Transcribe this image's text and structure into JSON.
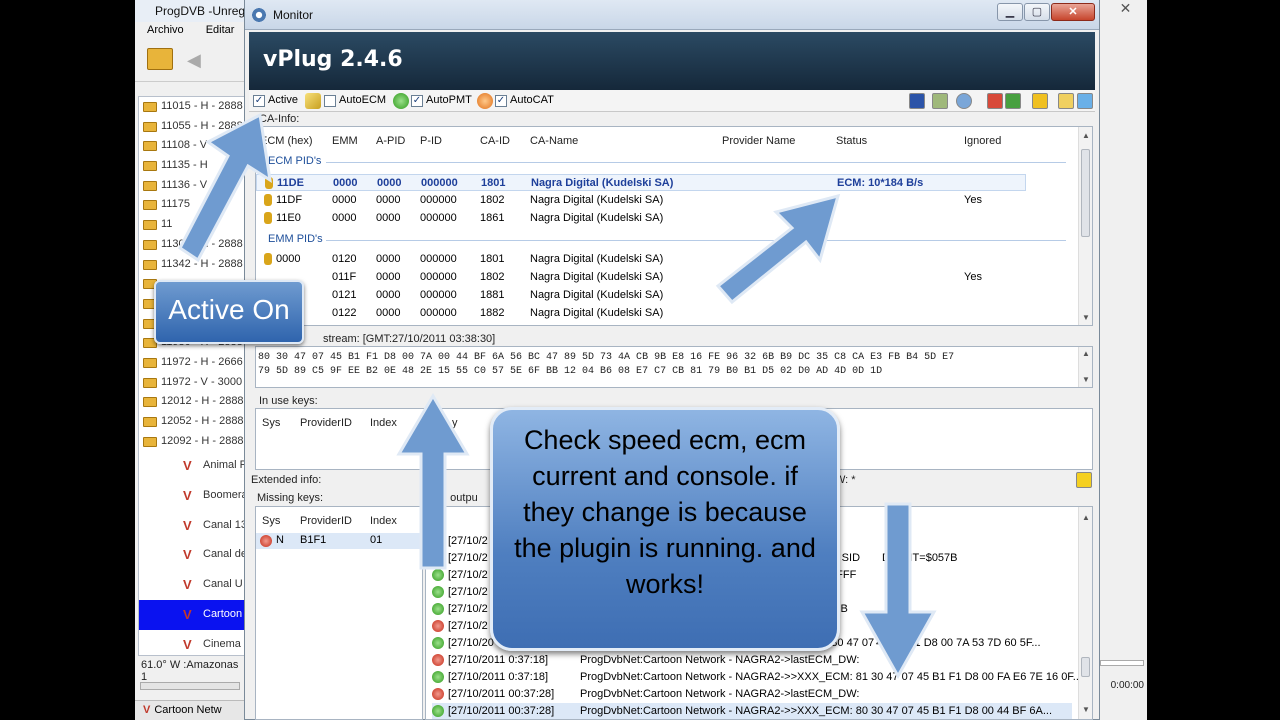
{
  "background_app": {
    "title": "ProgDVB -Unreg",
    "menu": [
      "Archivo",
      "Editar"
    ],
    "transponders": [
      "11015 - H - 2888",
      "11055 - H - 2888",
      "11108 - V",
      "11135 - H",
      "11136 - V",
      "11175",
      "11",
      "11302 - H - 2888",
      "11342 - H - 2888",
      "",
      "",
      "",
      "11930 - H - 2888",
      "11972 - H - 2666",
      "11972 - V - 3000",
      "12012 - H - 2888",
      "12052 - H - 2888",
      "12092 - H - 2888"
    ],
    "channels": [
      "Animal P",
      "Boomera",
      "Canal 13",
      "Canal de",
      "Canal U",
      "Cartoon",
      "Cinema"
    ],
    "selected_channel": "Cartoon",
    "status_text": "61.0° W :Amazonas 1",
    "bottom_text": "Cartoon Netw",
    "right_time": "0:00:00"
  },
  "monitor": {
    "window_title": "Monitor",
    "banner_title": "vPlug 2.4.6",
    "toolbar": {
      "active_label": "Active",
      "autoecm_label": "AutoECM",
      "autopmt_label": "AutoPMT",
      "autocat_label": "AutoCAT"
    },
    "ca_info_label": "CA-Info:",
    "ca_columns": [
      "ECM (hex)",
      "EMM",
      "A-PID",
      "P-ID",
      "CA-ID",
      "CA-Name",
      "Provider Name",
      "Status",
      "Ignored"
    ],
    "ecm_group_label": "ECM PID's",
    "ecm_rows": [
      {
        "ecm": "11DE",
        "emm": "0000",
        "apid": "0000",
        "pid": "000000",
        "caid": "1801",
        "caname": "Nagra Digital (Kudelski SA)",
        "provider": "",
        "status": "ECM: 10*184 B/s",
        "ignored": ""
      },
      {
        "ecm": "11DF",
        "emm": "0000",
        "apid": "0000",
        "pid": "000000",
        "caid": "1802",
        "caname": "Nagra Digital (Kudelski SA)",
        "provider": "",
        "status": "",
        "ignored": "Yes"
      },
      {
        "ecm": "11E0",
        "emm": "0000",
        "apid": "0000",
        "pid": "000000",
        "caid": "1861",
        "caname": "Nagra Digital (Kudelski SA)",
        "provider": "",
        "status": "",
        "ignored": ""
      }
    ],
    "emm_group_label": "EMM PID's",
    "emm_rows": [
      {
        "ecm": "0000",
        "emm": "0120",
        "apid": "0000",
        "pid": "000000",
        "caid": "1801",
        "caname": "Nagra Digital (Kudelski SA)",
        "ignored": ""
      },
      {
        "ecm": "",
        "emm": "011F",
        "apid": "0000",
        "pid": "000000",
        "caid": "1802",
        "caname": "Nagra Digital (Kudelski SA)",
        "ignored": "Yes"
      },
      {
        "ecm": "",
        "emm": "0121",
        "apid": "0000",
        "pid": "000000",
        "caid": "1881",
        "caname": "Nagra Digital (Kudelski SA)",
        "ignored": ""
      },
      {
        "ecm": "",
        "emm": "0122",
        "apid": "0000",
        "pid": "000000",
        "caid": "1882",
        "caname": "Nagra Digital (Kudelski SA)",
        "ignored": ""
      }
    ],
    "stream_label": "stream: [GMT:27/10/2011 03:38:30]",
    "hex_line1": "80 30 47 07 45 B1 F1 D8 00 7A 00 44 BF 6A 56 BC 47 89 5D 73 4A CB 9B E8 16 FE 96 32 6B B9 DC 35 C8 CA E3 FB B4 5D E7",
    "hex_line2": "79 5D 89 C5 9F EE B2 0E 48 2E 15 55 C0 57 5E 6F BB 12 04 B6 08 E7 C7 CB 81 79 B0 B1 D5 02 D0 AD 4D 0D 1D",
    "in_use_label": "In use keys:",
    "key_columns": [
      "Sys",
      "ProviderID",
      "Index"
    ],
    "key_col_extra": "y",
    "extended_label": "Extended info:",
    "extended_right": "W: *",
    "missing_label": "Missing keys:",
    "missing_row": {
      "sys": "N",
      "provider": "B1F1",
      "index": "01"
    },
    "log_label": "g outpu",
    "log_rows": [
      {
        "status": "ok",
        "text": "[27/10/2"
      },
      {
        "status": "ok",
        "text": "[27/10/2",
        "tail": "00A, SID",
        "tail2": "D, PMT=$057B"
      },
      {
        "status": "ok",
        "text": "[27/10/2",
        "tail": "FFFFFF"
      },
      {
        "status": "ok",
        "text": "[27/10/2"
      },
      {
        "status": "ok",
        "text": "[27/10/2",
        "tail": "$057B"
      },
      {
        "status": "err",
        "text": "[27/10/2"
      },
      {
        "status": "ok",
        "text": "[27/10/20",
        "tail": "80 30 47 07",
        "tail2": "45 B1 F1 D8 00 7A 53 7D 60 5F..."
      },
      {
        "status": "err",
        "text": "[27/10/2011 0:37:18]",
        "msg": "ProgDvbNet:Cartoon Network - NAGRA2->lastECM_DW:"
      },
      {
        "status": "ok",
        "text": "[27/10/2011 0:37:18]",
        "msg": "ProgDvbNet:Cartoon Network - NAGRA2->>XXX_ECM: 81 30 47 07 45 B1 F1 D8 00 FA E6 7E 16 0F..."
      },
      {
        "status": "err",
        "text": "[27/10/2011 00:37:28]",
        "msg": "ProgDvbNet:Cartoon Network - NAGRA2->lastECM_DW:"
      },
      {
        "status": "ok",
        "text": "[27/10/2011 00:37:28]",
        "msg": "ProgDvbNet:Cartoon Network - NAGRA2->>XXX_ECM: 80 30 47 07 45 B1 F1 D8 00 44 BF 6A..."
      }
    ]
  },
  "annotations": {
    "active_on": "Active On",
    "callout": "Check speed ecm, ecm current and console. if they change is because the plugin is running. and works!"
  },
  "colors": {
    "banner": "#1e3850",
    "accent": "#1e4f9a",
    "selection": "#0a12f0",
    "arrow": "#6f9bd0"
  }
}
